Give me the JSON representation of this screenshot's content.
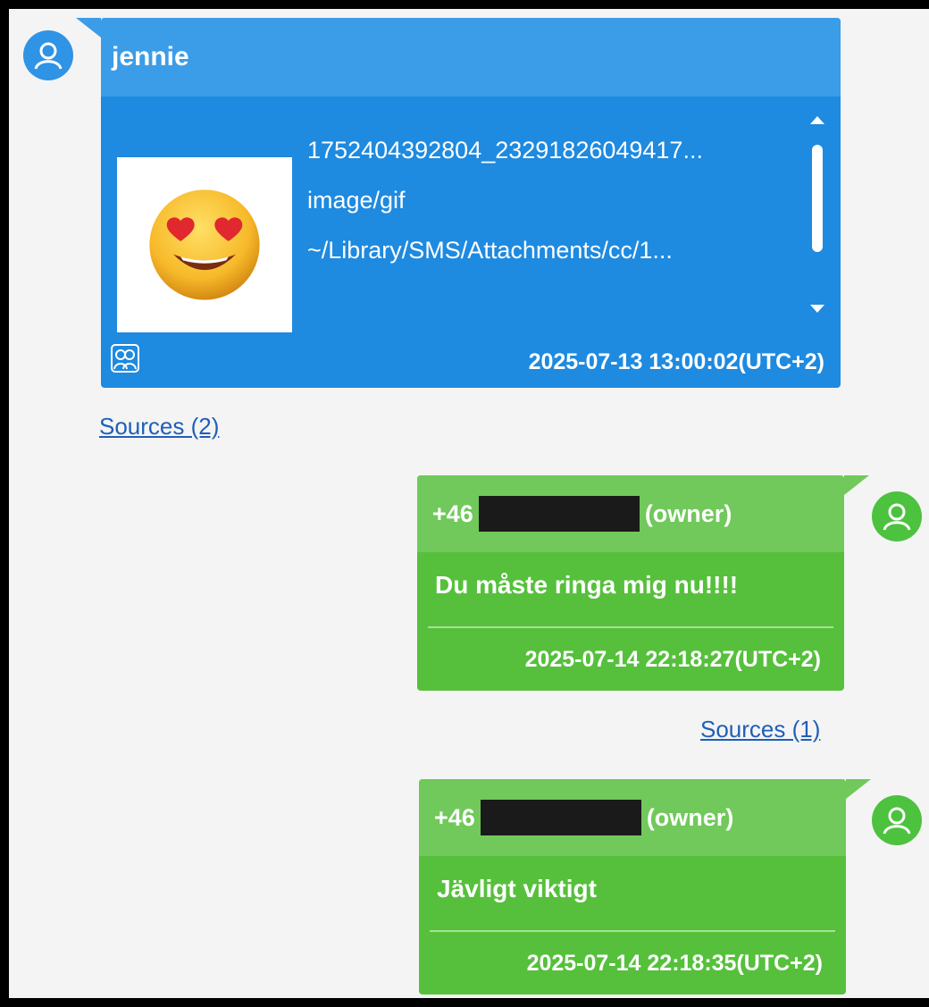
{
  "messages": [
    {
      "sender": "jennie",
      "file": {
        "name": "1752404392804_23291826049417...",
        "mime": "image/gif",
        "path": "~/Library/SMS/Attachments/cc/1...",
        "thumbnail_icon": "heart-eyes-emoji-icon"
      },
      "timestamp": "2025-07-13 13:00:02(UTC+2)",
      "sources": "Sources (2)",
      "avatar_color": "#2f93e6",
      "bubble_color": "#1e8ae0"
    },
    {
      "sender_prefix": "+46",
      "sender_suffix": "(owner)",
      "text": "Du måste ringa mig nu!!!!",
      "timestamp": "2025-07-14 22:18:27(UTC+2)",
      "sources": "Sources (1)",
      "avatar_color": "#4cc23f",
      "bubble_color": "#56c03c"
    },
    {
      "sender_prefix": "+46",
      "sender_suffix": "(owner)",
      "text": "Jävligt viktigt",
      "timestamp": "2025-07-14 22:18:35(UTC+2)"
    }
  ]
}
